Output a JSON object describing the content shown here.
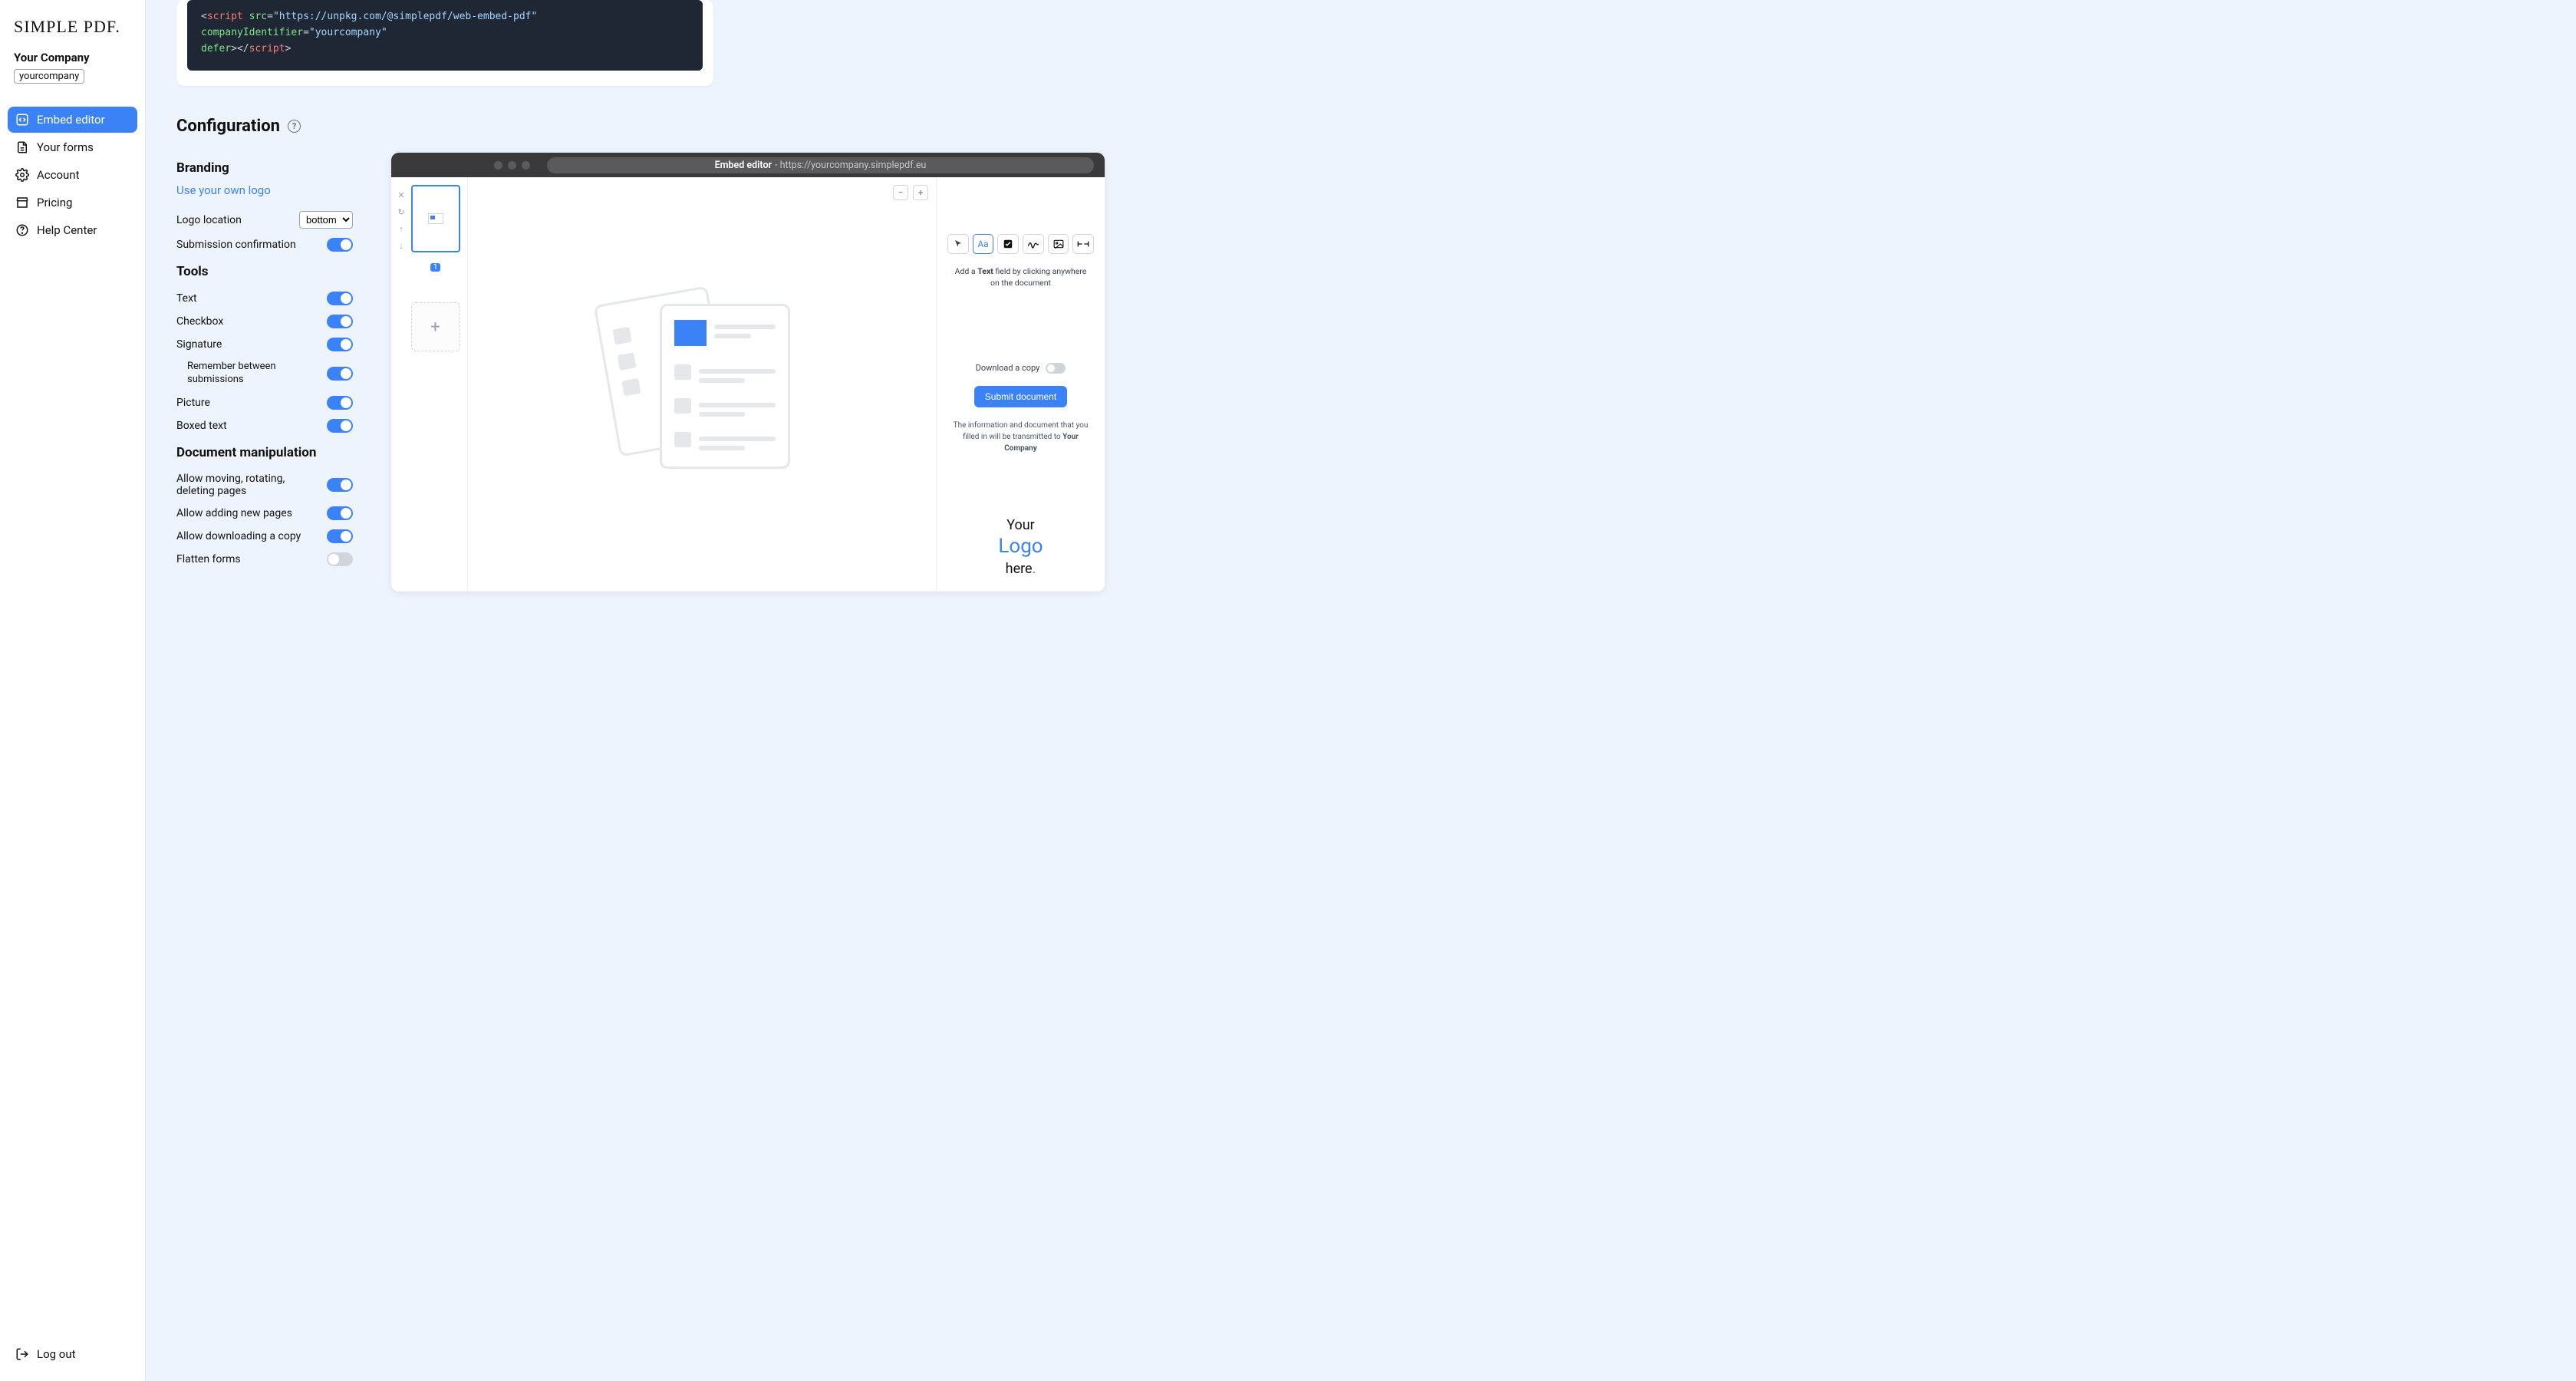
{
  "brand": "SIMPLE PDF.",
  "company": {
    "name": "Your Company",
    "slug": "yourcompany"
  },
  "nav": {
    "embed": "Embed editor",
    "forms": "Your forms",
    "account": "Account",
    "pricing": "Pricing",
    "help": "Help Center",
    "logout": "Log out"
  },
  "codeSnippet": {
    "tag": "script",
    "attrs": {
      "src": "https://unpkg.com/@simplepdf/web-embed-pdf",
      "companyIdentifier": "yourcompany",
      "defer": ""
    }
  },
  "config": {
    "title": "Configuration",
    "branding": {
      "heading": "Branding",
      "ownLogoLink": "Use your own logo",
      "logoLocationLabel": "Logo location",
      "logoLocationValue": "bottom",
      "submissionConfirmLabel": "Submission confirmation",
      "submissionConfirm": true
    },
    "tools": {
      "heading": "Tools",
      "textLabel": "Text",
      "text": true,
      "checkboxLabel": "Checkbox",
      "checkbox": true,
      "signatureLabel": "Signature",
      "signature": true,
      "rememberLabel": "Remember between submissions",
      "remember": true,
      "pictureLabel": "Picture",
      "picture": true,
      "boxedLabel": "Boxed text",
      "boxed": true
    },
    "docmanip": {
      "heading": "Document manipulation",
      "moveLabel": "Allow moving, rotating, deleting pages",
      "move": true,
      "addLabel": "Allow adding new pages",
      "add": true,
      "downloadLabel": "Allow downloading a copy",
      "download": true,
      "flattenLabel": "Flatten forms",
      "flatten": false
    }
  },
  "preview": {
    "titleBold": "Embed editor",
    "titleSep": " - ",
    "url": "https://yourcompany.simplepdf.eu",
    "pageNumber": "1",
    "toolHint_pre": "Add a ",
    "toolHint_bold": "Text",
    "toolHint_post": " field by clicking anywhere on the document",
    "downloadLabel": "Download a copy",
    "downloadOn": false,
    "submitLabel": "Submit document",
    "disclaimer_pre": "The information and document that you filled in will be transmitted to ",
    "disclaimer_bold": "Your Company",
    "logo_l1": "Your",
    "logo_l2": "Logo",
    "logo_l3_a": "here",
    "logo_l3_b": "."
  }
}
